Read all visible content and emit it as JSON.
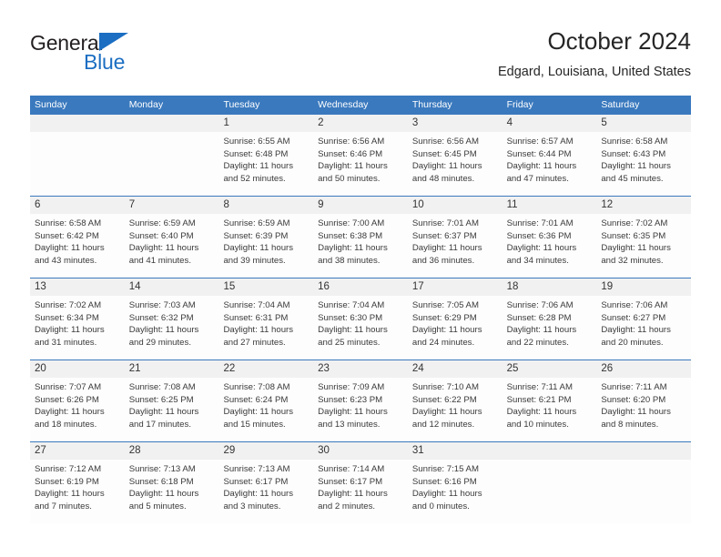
{
  "brand": {
    "name_part1": "General",
    "name_part2": "Blue",
    "triangle_color": "#1b6ec2",
    "text_color": "#231f20"
  },
  "header": {
    "title": "October 2024",
    "subtitle": "Edgard, Louisiana, United States",
    "header_bar_color": "#3a79be",
    "num_band_color": "#f1f1f1"
  },
  "weekdays": [
    "Sunday",
    "Monday",
    "Tuesday",
    "Wednesday",
    "Thursday",
    "Friday",
    "Saturday"
  ],
  "weeks": [
    {
      "days": [
        {
          "num": "",
          "sunrise": "",
          "sunset": "",
          "daylight1": "",
          "daylight2": ""
        },
        {
          "num": "",
          "sunrise": "",
          "sunset": "",
          "daylight1": "",
          "daylight2": ""
        },
        {
          "num": "1",
          "sunrise": "Sunrise: 6:55 AM",
          "sunset": "Sunset: 6:48 PM",
          "daylight1": "Daylight: 11 hours",
          "daylight2": "and 52 minutes."
        },
        {
          "num": "2",
          "sunrise": "Sunrise: 6:56 AM",
          "sunset": "Sunset: 6:46 PM",
          "daylight1": "Daylight: 11 hours",
          "daylight2": "and 50 minutes."
        },
        {
          "num": "3",
          "sunrise": "Sunrise: 6:56 AM",
          "sunset": "Sunset: 6:45 PM",
          "daylight1": "Daylight: 11 hours",
          "daylight2": "and 48 minutes."
        },
        {
          "num": "4",
          "sunrise": "Sunrise: 6:57 AM",
          "sunset": "Sunset: 6:44 PM",
          "daylight1": "Daylight: 11 hours",
          "daylight2": "and 47 minutes."
        },
        {
          "num": "5",
          "sunrise": "Sunrise: 6:58 AM",
          "sunset": "Sunset: 6:43 PM",
          "daylight1": "Daylight: 11 hours",
          "daylight2": "and 45 minutes."
        }
      ]
    },
    {
      "days": [
        {
          "num": "6",
          "sunrise": "Sunrise: 6:58 AM",
          "sunset": "Sunset: 6:42 PM",
          "daylight1": "Daylight: 11 hours",
          "daylight2": "and 43 minutes."
        },
        {
          "num": "7",
          "sunrise": "Sunrise: 6:59 AM",
          "sunset": "Sunset: 6:40 PM",
          "daylight1": "Daylight: 11 hours",
          "daylight2": "and 41 minutes."
        },
        {
          "num": "8",
          "sunrise": "Sunrise: 6:59 AM",
          "sunset": "Sunset: 6:39 PM",
          "daylight1": "Daylight: 11 hours",
          "daylight2": "and 39 minutes."
        },
        {
          "num": "9",
          "sunrise": "Sunrise: 7:00 AM",
          "sunset": "Sunset: 6:38 PM",
          "daylight1": "Daylight: 11 hours",
          "daylight2": "and 38 minutes."
        },
        {
          "num": "10",
          "sunrise": "Sunrise: 7:01 AM",
          "sunset": "Sunset: 6:37 PM",
          "daylight1": "Daylight: 11 hours",
          "daylight2": "and 36 minutes."
        },
        {
          "num": "11",
          "sunrise": "Sunrise: 7:01 AM",
          "sunset": "Sunset: 6:36 PM",
          "daylight1": "Daylight: 11 hours",
          "daylight2": "and 34 minutes."
        },
        {
          "num": "12",
          "sunrise": "Sunrise: 7:02 AM",
          "sunset": "Sunset: 6:35 PM",
          "daylight1": "Daylight: 11 hours",
          "daylight2": "and 32 minutes."
        }
      ]
    },
    {
      "days": [
        {
          "num": "13",
          "sunrise": "Sunrise: 7:02 AM",
          "sunset": "Sunset: 6:34 PM",
          "daylight1": "Daylight: 11 hours",
          "daylight2": "and 31 minutes."
        },
        {
          "num": "14",
          "sunrise": "Sunrise: 7:03 AM",
          "sunset": "Sunset: 6:32 PM",
          "daylight1": "Daylight: 11 hours",
          "daylight2": "and 29 minutes."
        },
        {
          "num": "15",
          "sunrise": "Sunrise: 7:04 AM",
          "sunset": "Sunset: 6:31 PM",
          "daylight1": "Daylight: 11 hours",
          "daylight2": "and 27 minutes."
        },
        {
          "num": "16",
          "sunrise": "Sunrise: 7:04 AM",
          "sunset": "Sunset: 6:30 PM",
          "daylight1": "Daylight: 11 hours",
          "daylight2": "and 25 minutes."
        },
        {
          "num": "17",
          "sunrise": "Sunrise: 7:05 AM",
          "sunset": "Sunset: 6:29 PM",
          "daylight1": "Daylight: 11 hours",
          "daylight2": "and 24 minutes."
        },
        {
          "num": "18",
          "sunrise": "Sunrise: 7:06 AM",
          "sunset": "Sunset: 6:28 PM",
          "daylight1": "Daylight: 11 hours",
          "daylight2": "and 22 minutes."
        },
        {
          "num": "19",
          "sunrise": "Sunrise: 7:06 AM",
          "sunset": "Sunset: 6:27 PM",
          "daylight1": "Daylight: 11 hours",
          "daylight2": "and 20 minutes."
        }
      ]
    },
    {
      "days": [
        {
          "num": "20",
          "sunrise": "Sunrise: 7:07 AM",
          "sunset": "Sunset: 6:26 PM",
          "daylight1": "Daylight: 11 hours",
          "daylight2": "and 18 minutes."
        },
        {
          "num": "21",
          "sunrise": "Sunrise: 7:08 AM",
          "sunset": "Sunset: 6:25 PM",
          "daylight1": "Daylight: 11 hours",
          "daylight2": "and 17 minutes."
        },
        {
          "num": "22",
          "sunrise": "Sunrise: 7:08 AM",
          "sunset": "Sunset: 6:24 PM",
          "daylight1": "Daylight: 11 hours",
          "daylight2": "and 15 minutes."
        },
        {
          "num": "23",
          "sunrise": "Sunrise: 7:09 AM",
          "sunset": "Sunset: 6:23 PM",
          "daylight1": "Daylight: 11 hours",
          "daylight2": "and 13 minutes."
        },
        {
          "num": "24",
          "sunrise": "Sunrise: 7:10 AM",
          "sunset": "Sunset: 6:22 PM",
          "daylight1": "Daylight: 11 hours",
          "daylight2": "and 12 minutes."
        },
        {
          "num": "25",
          "sunrise": "Sunrise: 7:11 AM",
          "sunset": "Sunset: 6:21 PM",
          "daylight1": "Daylight: 11 hours",
          "daylight2": "and 10 minutes."
        },
        {
          "num": "26",
          "sunrise": "Sunrise: 7:11 AM",
          "sunset": "Sunset: 6:20 PM",
          "daylight1": "Daylight: 11 hours",
          "daylight2": "and 8 minutes."
        }
      ]
    },
    {
      "days": [
        {
          "num": "27",
          "sunrise": "Sunrise: 7:12 AM",
          "sunset": "Sunset: 6:19 PM",
          "daylight1": "Daylight: 11 hours",
          "daylight2": "and 7 minutes."
        },
        {
          "num": "28",
          "sunrise": "Sunrise: 7:13 AM",
          "sunset": "Sunset: 6:18 PM",
          "daylight1": "Daylight: 11 hours",
          "daylight2": "and 5 minutes."
        },
        {
          "num": "29",
          "sunrise": "Sunrise: 7:13 AM",
          "sunset": "Sunset: 6:17 PM",
          "daylight1": "Daylight: 11 hours",
          "daylight2": "and 3 minutes."
        },
        {
          "num": "30",
          "sunrise": "Sunrise: 7:14 AM",
          "sunset": "Sunset: 6:17 PM",
          "daylight1": "Daylight: 11 hours",
          "daylight2": "and 2 minutes."
        },
        {
          "num": "31",
          "sunrise": "Sunrise: 7:15 AM",
          "sunset": "Sunset: 6:16 PM",
          "daylight1": "Daylight: 11 hours",
          "daylight2": "and 0 minutes."
        },
        {
          "num": "",
          "sunrise": "",
          "sunset": "",
          "daylight1": "",
          "daylight2": ""
        },
        {
          "num": "",
          "sunrise": "",
          "sunset": "",
          "daylight1": "",
          "daylight2": ""
        }
      ]
    }
  ]
}
